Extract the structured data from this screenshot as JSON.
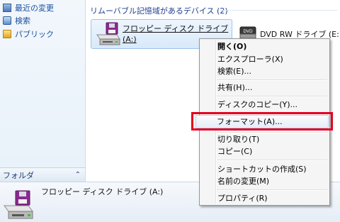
{
  "nav": {
    "items": [
      {
        "label": "最近の変更",
        "icon": "recent-places-icon"
      },
      {
        "label": "検索",
        "icon": "search-folder-icon"
      },
      {
        "label": "パブリック",
        "icon": "public-folder-icon"
      }
    ],
    "folder_bar_label": "フォルダ",
    "folder_bar_chevron": "⌃"
  },
  "content": {
    "group_header": "リムーバブル記憶域があるデバイス (2)",
    "devices": [
      {
        "label_line1": "フロッピー ディスク ドライブ",
        "label_line2": "(A:)",
        "icon": "floppy-drive-icon"
      },
      {
        "label": "DVD RW ドライブ (E:)",
        "icon": "dvd-drive-icon"
      }
    ]
  },
  "details": {
    "title": "フロッピー ディスク ドライブ (A:)"
  },
  "context_menu": {
    "items": [
      {
        "label": "開く(O)",
        "bold": true
      },
      {
        "label": "エクスプローラ(X)"
      },
      {
        "label": "検索(E)..."
      },
      {
        "label": "共有(H)..."
      },
      {
        "label": "ディスクのコピー(Y)..."
      },
      {
        "label": "フォーマット(A)...",
        "highlighted": true
      },
      {
        "label": "切り取り(T)"
      },
      {
        "label": "コピー(C)"
      },
      {
        "label": "ショートカットの作成(S)"
      },
      {
        "label": "名前の変更(M)"
      },
      {
        "label": "プロパティ(R)"
      }
    ]
  },
  "colors": {
    "highlight_box": "#e5001c",
    "nav_text": "#1a4f9c",
    "group_header_text": "#1e3f8f"
  }
}
